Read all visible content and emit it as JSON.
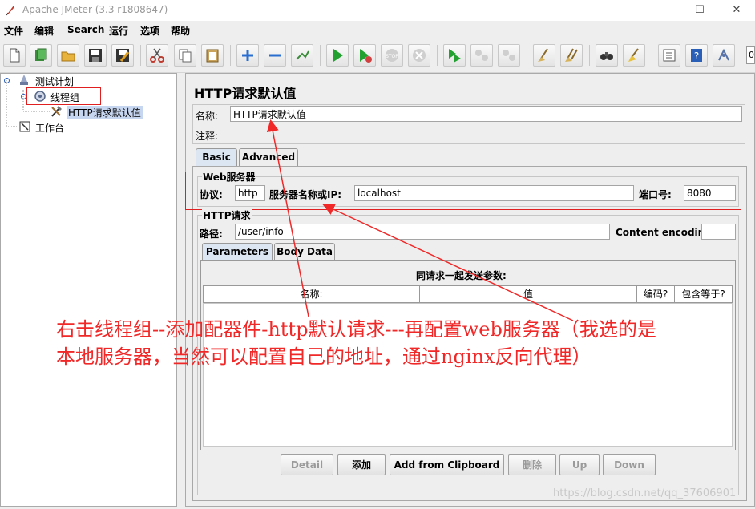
{
  "window": {
    "title": "Apache JMeter (3.3 r1808647)",
    "controls": {
      "minimize": "—",
      "maximize": "☐",
      "close": "✕"
    }
  },
  "menu": [
    "文件",
    "编辑",
    "Search",
    "运行",
    "选项",
    "帮助"
  ],
  "toolbar": {
    "buttons": [
      "new-icon",
      "templates-icon",
      "open-icon",
      "save-icon",
      "save-as-icon",
      "cut-icon",
      "copy-icon",
      "paste-icon",
      "expand-icon",
      "collapse-icon",
      "toggle-icon",
      "start-icon",
      "start-no-pause-icon",
      "stop-icon",
      "shutdown-icon",
      "remote-start-icon",
      "remote-stop-icon",
      "remote-exit-icon",
      "clear-icon",
      "clear-all-icon",
      "search-icon",
      "reset-search-icon",
      "function-helper-icon",
      "help-icon",
      "tree-icon"
    ],
    "counter_text": "0"
  },
  "tree": {
    "items": [
      {
        "label": "测试计划",
        "icon": "test-plan-icon"
      },
      {
        "label": "线程组",
        "icon": "thread-group-icon"
      },
      {
        "label": "HTTP请求默认值",
        "icon": "config-element-icon"
      },
      {
        "label": "工作台",
        "icon": "workbench-icon"
      }
    ]
  },
  "panel": {
    "title": "HTTP请求默认值",
    "name_label": "名称:",
    "name_value": "HTTP请求默认值",
    "comment_label": "注释:",
    "comment_value": "",
    "tabs": [
      "Basic",
      "Advanced"
    ],
    "web_server": {
      "group_label": "Web服务器",
      "protocol_label": "协议:",
      "protocol_value": "http",
      "server_label": "服务器名称或IP:",
      "server_value": "localhost",
      "port_label": "端口号:",
      "port_value": "8080"
    },
    "http_request": {
      "group_label": "HTTP请求",
      "path_label": "路径:",
      "path_value": "/user/info",
      "encoding_label": "Content encoding:",
      "encoding_value": ""
    },
    "subtabs": [
      "Parameters",
      "Body Data"
    ],
    "params": {
      "caption": "同请求一起发送参数:",
      "columns": [
        "名称:",
        "值",
        "编码?",
        "包含等于?"
      ]
    },
    "buttons": [
      {
        "label": "Detail",
        "enabled": false
      },
      {
        "label": "添加",
        "enabled": true
      },
      {
        "label": "Add from Clipboard",
        "enabled": true
      },
      {
        "label": "删除",
        "enabled": false
      },
      {
        "label": "Up",
        "enabled": false
      },
      {
        "label": "Down",
        "enabled": false
      }
    ]
  },
  "annotation": {
    "line1": "右击线程组--添加配器件-http默认请求---再配置web服务器（我选的是",
    "line2": "本地服务器，当然可以配置自己的地址，通过nginx反向代理）",
    "color": "#f02828"
  },
  "watermark": "https://blog.csdn.net/qq_37606901"
}
